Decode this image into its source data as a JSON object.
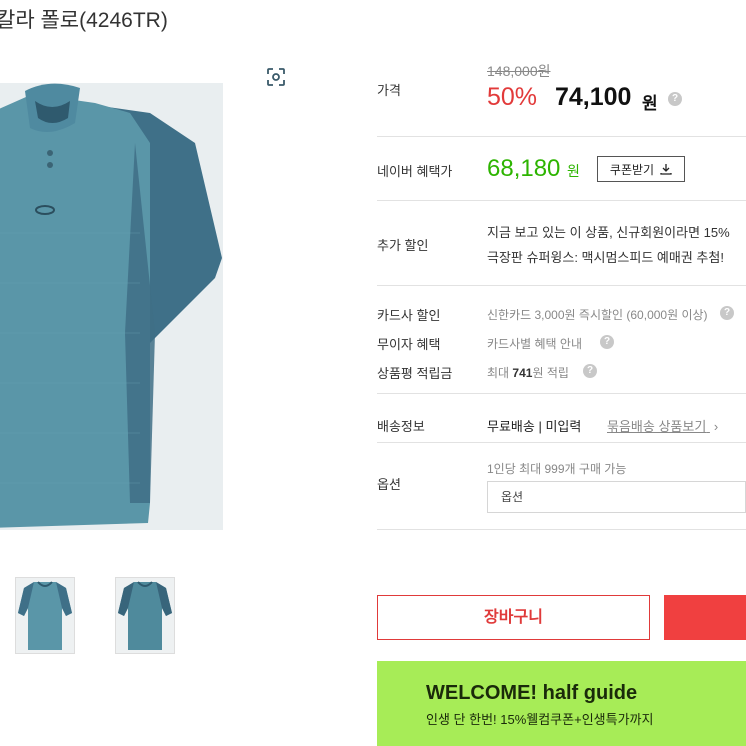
{
  "product": {
    "title": "칼라 폴로(4246TR)"
  },
  "price": {
    "label": "가격",
    "original": "148,000원",
    "discount_rate": "50%",
    "sale_price": "74,100",
    "currency": "원"
  },
  "naver": {
    "label": "네이버 혜택가",
    "price": "68,180",
    "currency": "원",
    "coupon_button": "쿠폰받기"
  },
  "extra_discount": {
    "label": "추가 할인",
    "line1": "지금 보고 있는 이 상품, 신규회원이라면 15%",
    "line2": "극장판 슈퍼윙스: 맥시멈스피드 예매권 추첨!"
  },
  "card_discount": {
    "label": "카드사 할인",
    "text": "신한카드 3,000원 즉시할인 (60,000원 이상)"
  },
  "interest_free": {
    "label": "무이자 혜택",
    "text": "카드사별 혜택 안내"
  },
  "review_points": {
    "label": "상품평 적립금",
    "prefix": "최대 ",
    "amount": "741",
    "suffix": "원 적립"
  },
  "shipping": {
    "label": "배송정보",
    "value": "무료배송 | 미입력",
    "link": "묶음배송 상품보기"
  },
  "option": {
    "label": "옵션",
    "hint": "1인당 최대 999개 구매 가능",
    "placeholder": "옵션"
  },
  "actions": {
    "cart": "장바구니"
  },
  "banner": {
    "title": "WELCOME! half guide",
    "subtitle": "인생 단 한번! 15%웰컴쿠폰+인생특가까지"
  },
  "colors": {
    "discount": "#e23a3a",
    "naver_green": "#2db400",
    "banner_bg": "#a7ec57",
    "shirt_body": "#5a96a8",
    "shirt_sleeve": "#3f7088"
  }
}
